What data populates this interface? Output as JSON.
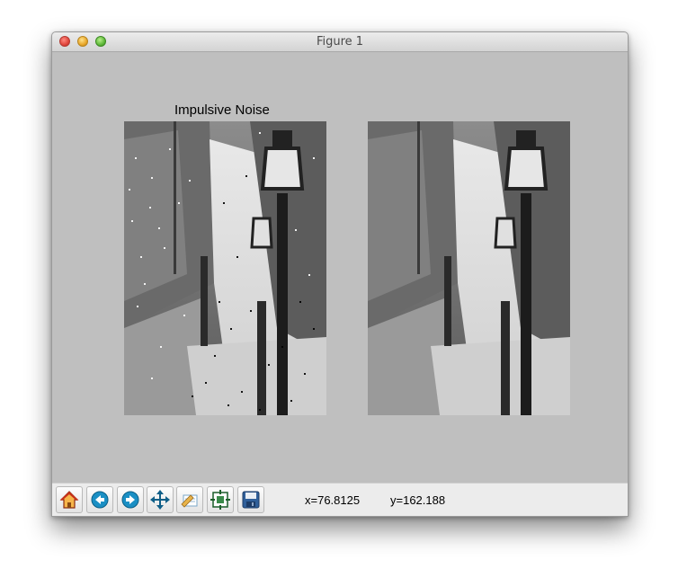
{
  "window": {
    "title": "Figure 1"
  },
  "figure": {
    "axes_title": "Impulsive Noise",
    "images": [
      {
        "description_name": "noisy-image"
      },
      {
        "description_name": "filtered-image"
      }
    ]
  },
  "toolbar": {
    "buttons": [
      "home-icon",
      "back-icon",
      "forward-icon",
      "pan-icon",
      "zoom-icon",
      "subplots-icon",
      "save-icon"
    ]
  },
  "status": {
    "x_readout": "x=76.8125",
    "y_readout": "y=162.188"
  },
  "colors": {
    "background": "#bfbfbf",
    "toolbar": "#ececec",
    "nav_arrow": "#1a8fc4"
  }
}
